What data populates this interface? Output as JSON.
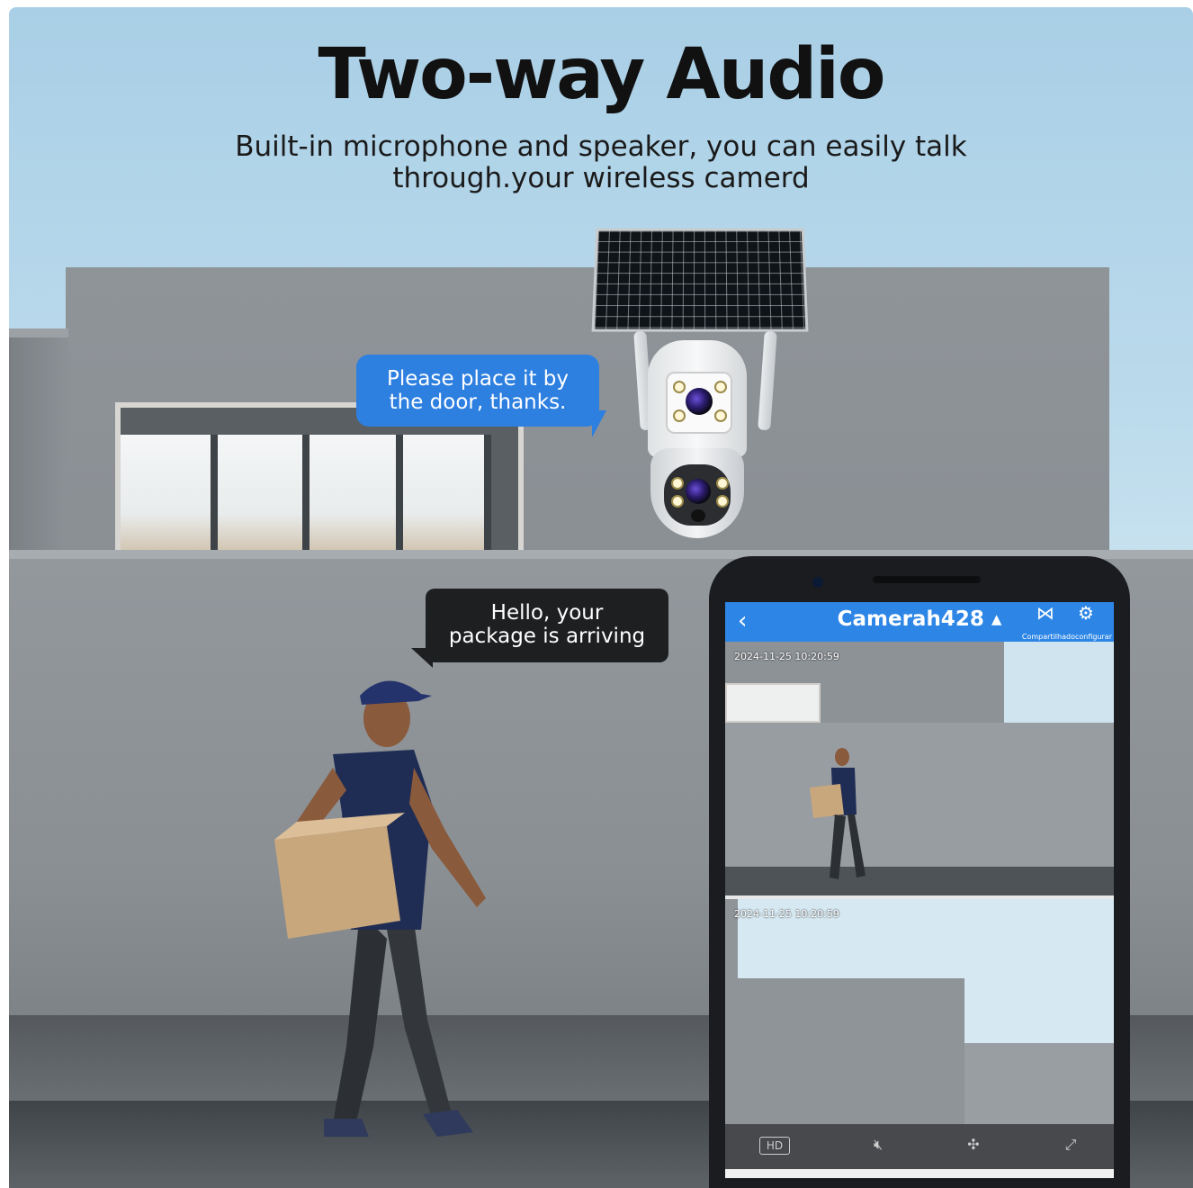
{
  "header": {
    "title": "Two-way Audio",
    "subtitle_line1": "Built-in microphone and speaker, you can easily talk",
    "subtitle_line2": "through.your wireless camerd"
  },
  "bubbles": {
    "camera_line1": "Please place it by",
    "camera_line2": "the door, thanks.",
    "courier_line1": "Hello, your",
    "courier_line2": "package is arriving"
  },
  "app": {
    "camera_name": "Camerah428 ▴",
    "share_label": "Compartilhadoconfigurar",
    "timestamp_1": "2024-11-25  10:20:59",
    "timestamp_2": "2024-11-25  10:20:59",
    "hd_label": "HD",
    "icons": [
      "back-icon",
      "share-icon",
      "settings-icon",
      "mute-icon",
      "ptz-icon",
      "fullscreen-icon"
    ]
  },
  "colors": {
    "app_accent": "#2d86e6",
    "bubble_blue": "#2d7fe0",
    "bubble_dark": "#1e1f21"
  }
}
